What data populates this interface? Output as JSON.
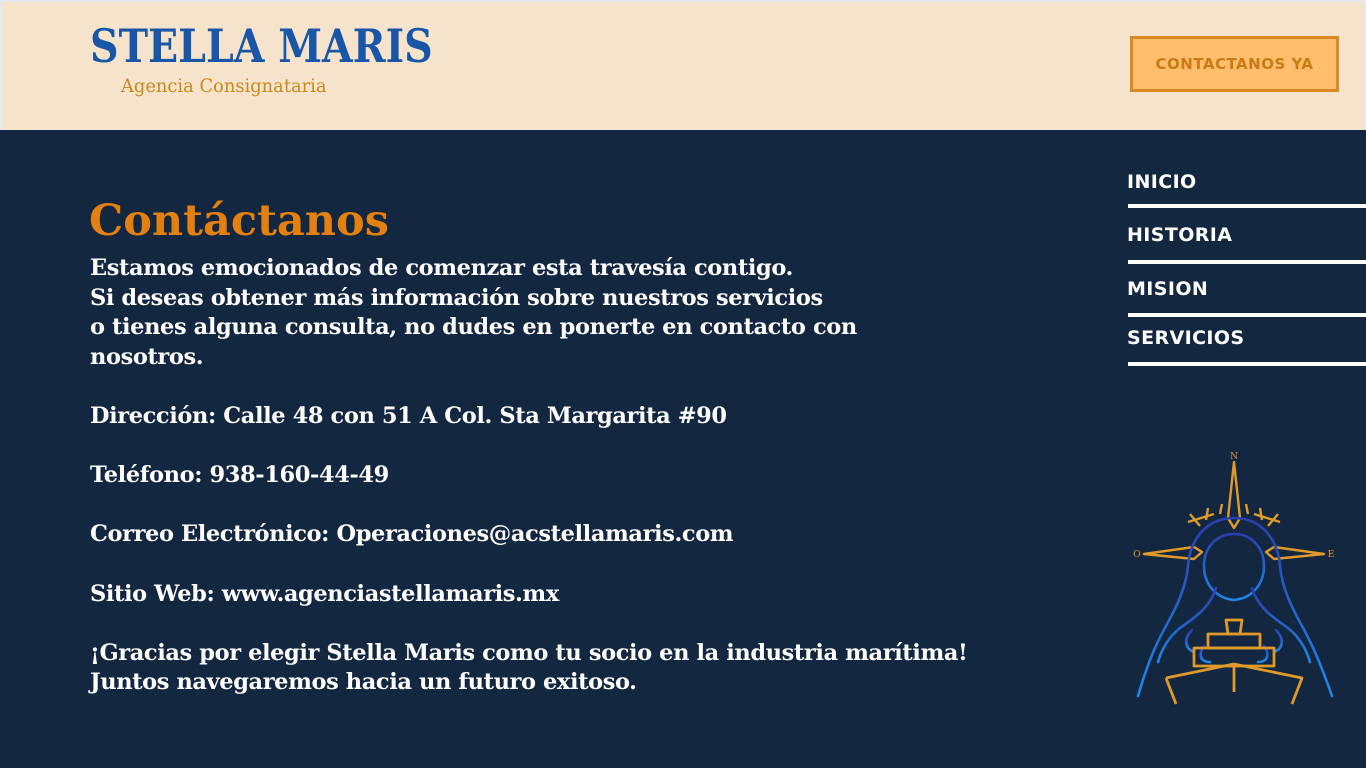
{
  "header": {
    "logo_title": "STELLA MARIS",
    "logo_subtitle": "Agencia Consignataria",
    "cta_label": "CONTACTANOS YA"
  },
  "main": {
    "title": "Contáctanos",
    "intro_lines": [
      "Estamos emocionados de comenzar esta travesía contigo.",
      "Si deseas obtener más información sobre nuestros servicios",
      "o tienes alguna consulta, no dudes en ponerte en contacto con",
      "nosotros."
    ],
    "address": "Dirección: Calle 48 con 51 A Col. Sta Margarita #90",
    "phone": "Teléfono: 938-160-44-49",
    "email": "Correo Electrónico: Operaciones@acstellamaris.com",
    "website": "Sitio Web: www.agenciastellamaris.mx",
    "closing_lines": [
      "¡Gracias por elegir Stella Maris como tu socio en la industria marítima!",
      "Juntos navegaremos hacia un futuro exitoso."
    ]
  },
  "nav": {
    "items": [
      {
        "label": "INICIO"
      },
      {
        "label": "HISTORIA"
      },
      {
        "label": "MISION"
      },
      {
        "label": "SERVICIOS"
      }
    ]
  },
  "illustration": {
    "icon": "compass-virgin-ship-icon",
    "compass_letters": {
      "north": "N",
      "west": "O",
      "east": "E"
    }
  },
  "colors": {
    "background": "#132741",
    "header_background": "#f6e3cb",
    "accent_orange": "#e4800f",
    "button_fill": "#ffbe6b",
    "logo_blue": "#1a56a8",
    "text": "#ffffff"
  }
}
